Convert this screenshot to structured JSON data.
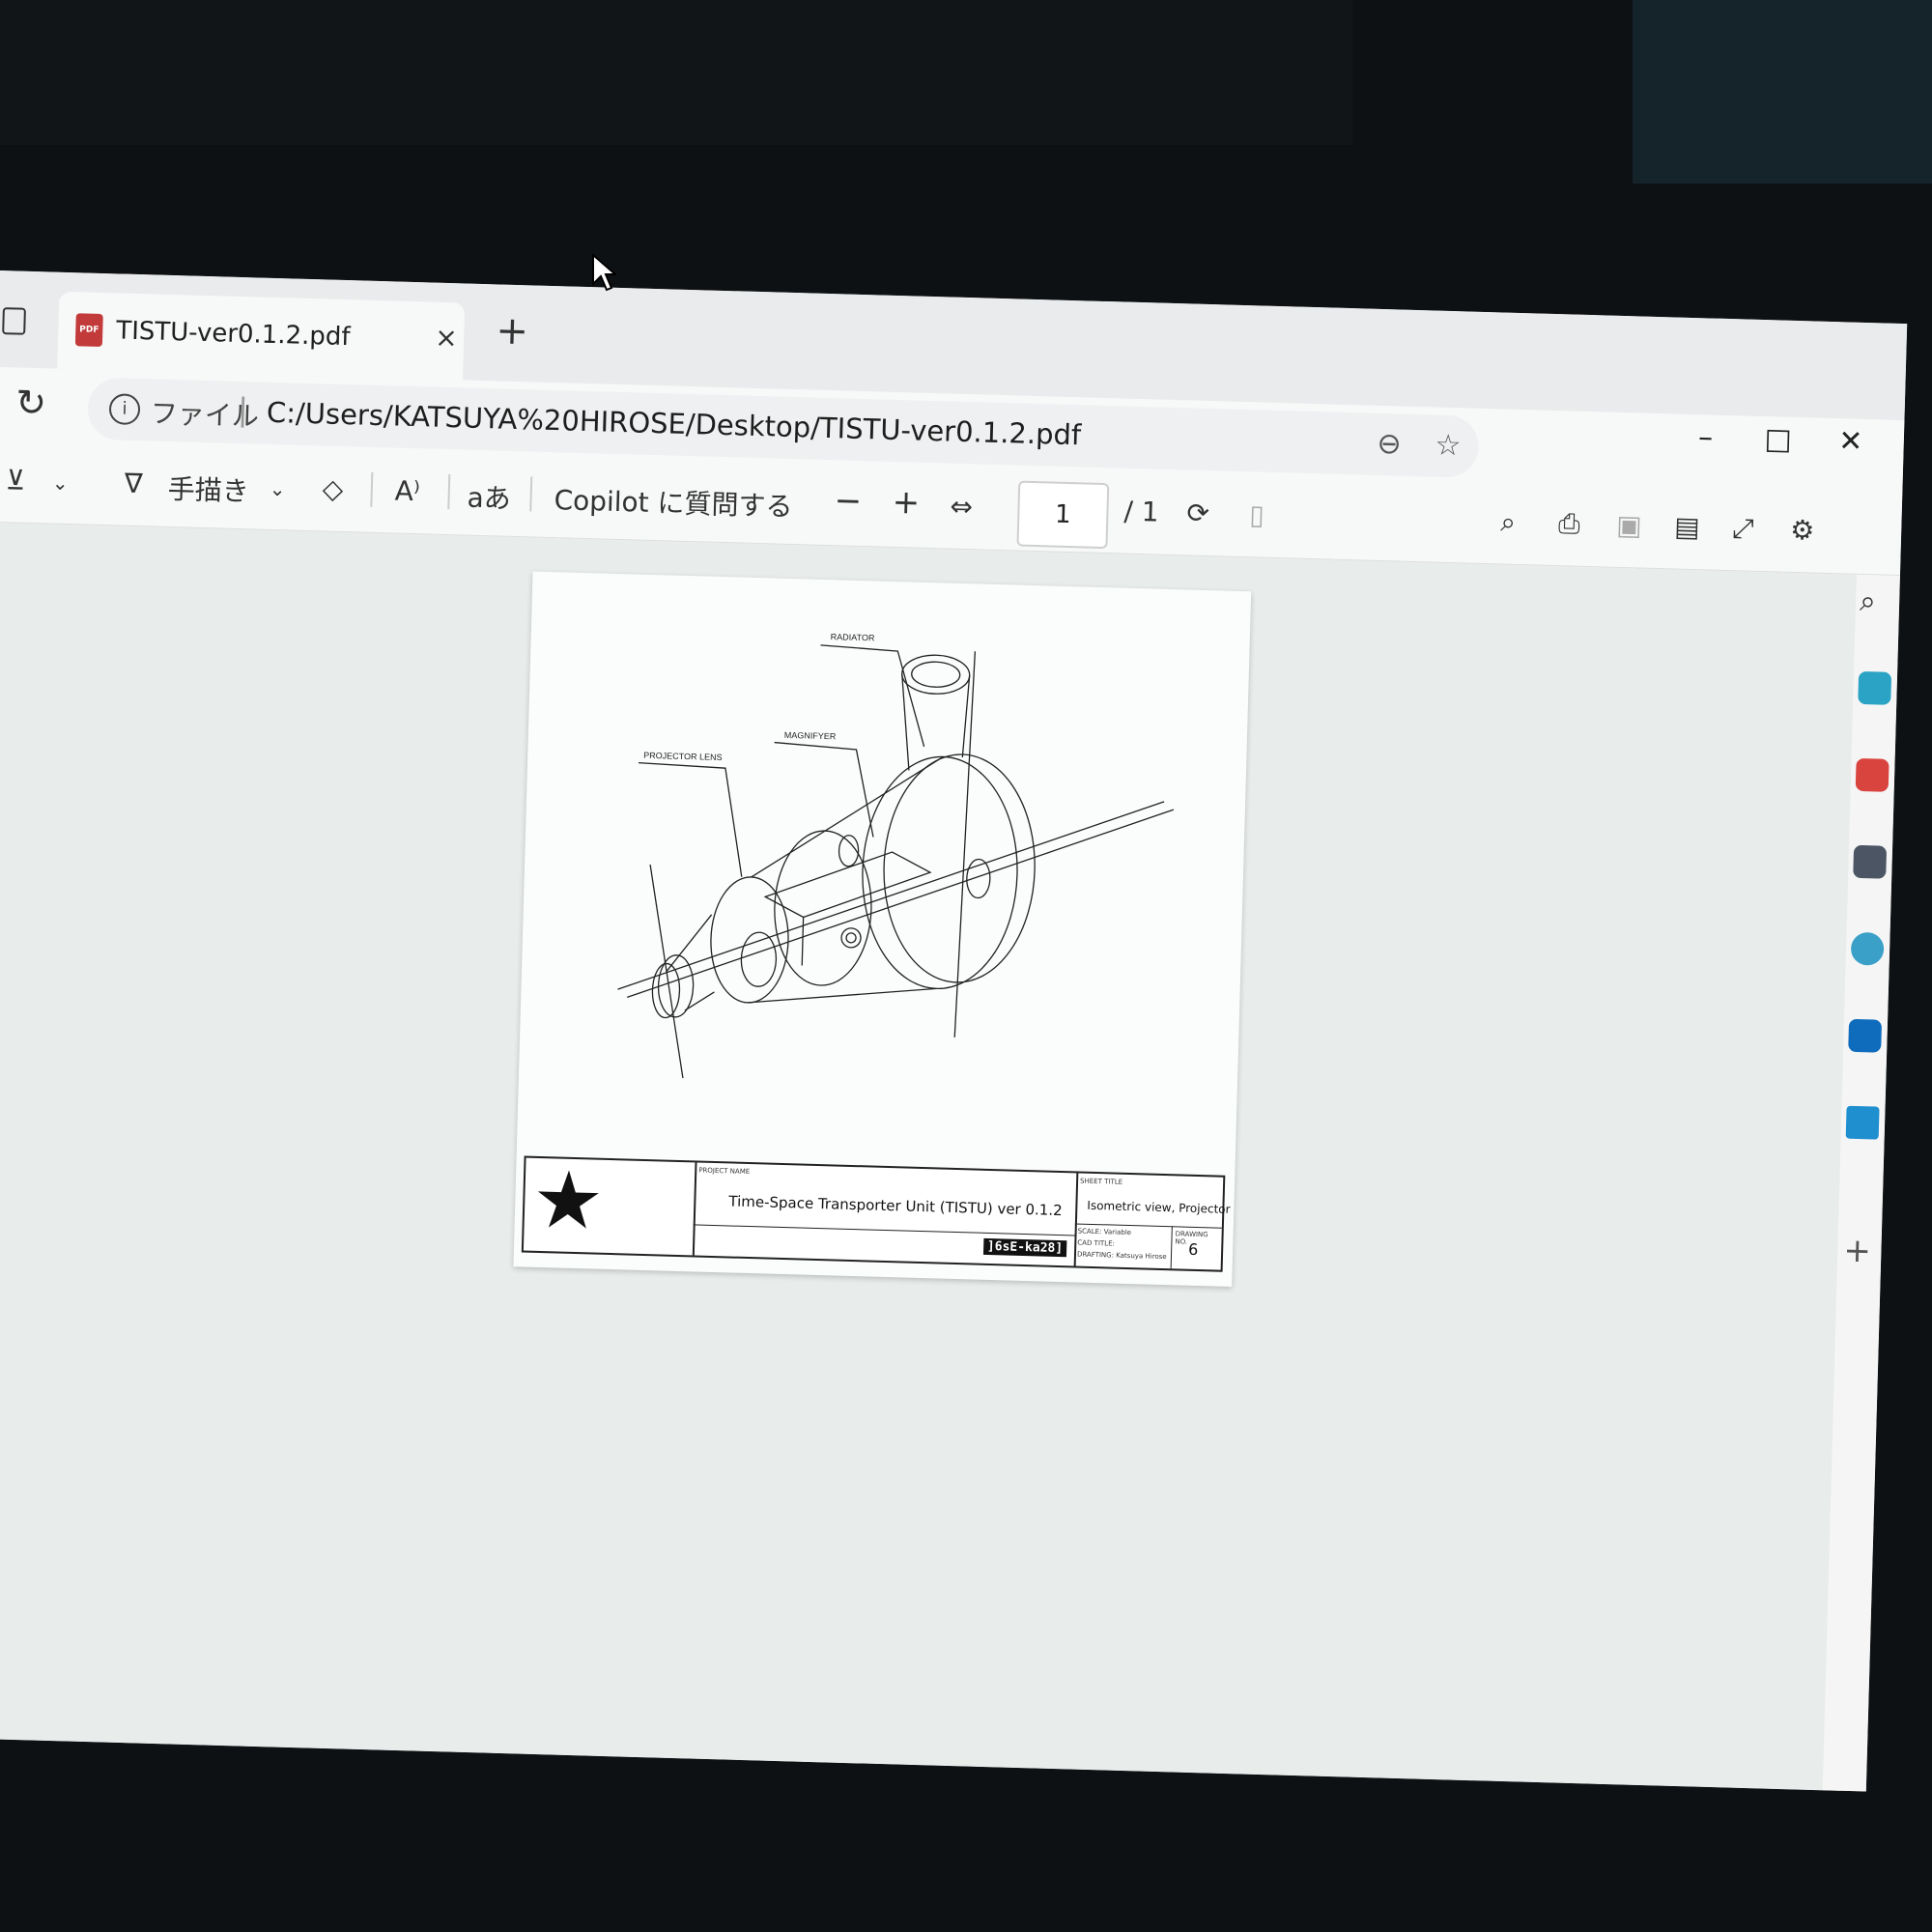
{
  "tab": {
    "title": "TISTU-ver0.1.2.pdf",
    "close_icon": "×",
    "new_tab_icon": "+"
  },
  "address": {
    "file_label": "ファイル",
    "url": "C:/Users/KATSUYA%20HIROSE/Desktop/TISTU-ver0.1.2.pdf"
  },
  "window_controls": {
    "minimize": "–",
    "maximize": "□",
    "close": "✕"
  },
  "toolbar": {
    "draw_label": "手描き",
    "read_aloud_label": "A⁾",
    "translate_label": "aあ",
    "copilot_label": "Copilot に質問する",
    "zoom_out": "−",
    "zoom_in": "+",
    "page_current": "1",
    "page_total": "/ 1"
  },
  "drawing": {
    "label_radiator": "RADIATOR",
    "label_magnifyer": "MAGNIFYER",
    "label_projector_lens": "PROJECTOR LENS"
  },
  "title_block": {
    "project_name_caption": "PROJECT NAME",
    "project_name": "Time-Space Transporter Unit (TISTU) ver 0.1.2",
    "code": "]6sE-ka28]",
    "sheet_title_caption": "SHEET TITLE",
    "sheet_title": "Isometric view, Projector",
    "scale_label": "SCALE: Variable",
    "cad_title_label": "CAD TITLE:",
    "drafting_label": "DRAFTING: Katsuya Hirose",
    "drawing_no_caption": "DRAWING NO.",
    "drawing_no": "6"
  },
  "colors": {
    "accent": "#0078d4",
    "pdf_icon": "#c23a3a"
  }
}
